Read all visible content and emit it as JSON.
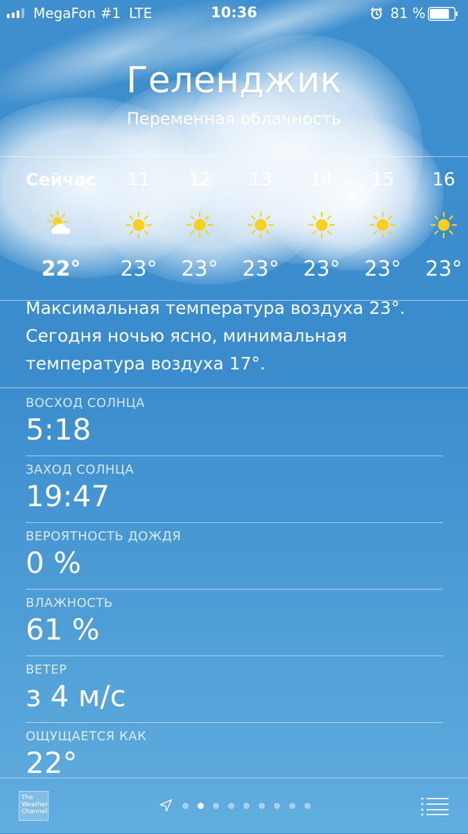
{
  "status_bar": {
    "carrier": "MegaFon #1",
    "network": "LTE",
    "time": "10:36",
    "battery": "81 %",
    "battery_level": 0.81,
    "signal_bars": 3,
    "signal_bars_total": 4
  },
  "header": {
    "city": "Геленджик",
    "condition": "Переменная облачность"
  },
  "hourly": [
    {
      "label": "Сейчас",
      "icon": "partly-cloudy-icon",
      "temp": "22°"
    },
    {
      "label": "11",
      "icon": "sun-icon",
      "temp": "23°"
    },
    {
      "label": "12",
      "icon": "sun-icon",
      "temp": "23°"
    },
    {
      "label": "13",
      "icon": "sun-icon",
      "temp": "23°"
    },
    {
      "label": "14",
      "icon": "sun-icon",
      "temp": "23°"
    },
    {
      "label": "15",
      "icon": "sun-icon",
      "temp": "23°"
    },
    {
      "label": "16",
      "icon": "sun-icon",
      "temp": "23°"
    }
  ],
  "summary": {
    "line1": "Максимальная температура воздуха 23°.",
    "line2": "Сегодня ночью ясно, минимальная",
    "line3": "температура воздуха 17°."
  },
  "details": [
    {
      "label": "ВОСХОД СОЛНЦА",
      "value": "5:18"
    },
    {
      "label": "ЗАХОД СОЛНЦА",
      "value": "19:47"
    },
    {
      "label": "ВЕРОЯТНОСТЬ ДОЖДЯ",
      "value": "0 %"
    },
    {
      "label": "ВЛАЖНОСТЬ",
      "value": "61 %"
    },
    {
      "label": "ВЕТЕР",
      "value": "з 4 м/с"
    },
    {
      "label": "ОЩУЩАЕТСЯ КАК",
      "value": "22°"
    }
  ],
  "bottom_bar": {
    "logo": {
      "line1": "The",
      "line2": "Weather",
      "line3": "Channel"
    },
    "page_count": 9,
    "active_page": 1
  },
  "colors": {
    "sun": "#f7d11e",
    "sky": "#3f8fce",
    "text": "#ffffff"
  }
}
